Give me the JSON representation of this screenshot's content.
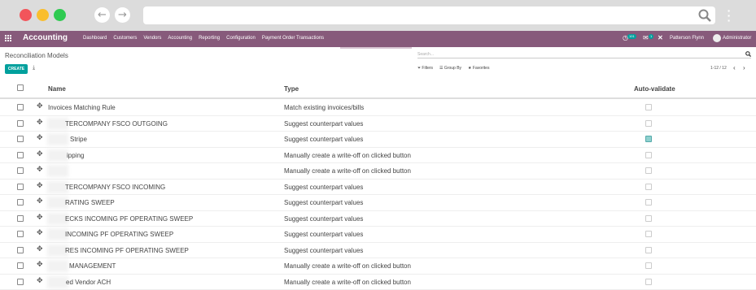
{
  "topbar": {
    "app_name": "Accounting",
    "menu": [
      "Dashboard",
      "Customers",
      "Vendors",
      "Accounting",
      "Reporting",
      "Configuration",
      "Payment Order Transactions"
    ],
    "activity_count": "101",
    "messages_count": "1",
    "company": "Patterson Flynn",
    "user": "Administrator"
  },
  "page": {
    "breadcrumb": "Reconciliation Models",
    "search_placeholder": "Search...",
    "create_label": "CREATE",
    "filters_label": "Filters",
    "group_by_label": "Group By",
    "favorites_label": "Favorites",
    "pager": "1-12 / 12"
  },
  "table": {
    "headers": {
      "name": "Name",
      "type": "Type",
      "auto_validate": "Auto-validate"
    },
    "rows": [
      {
        "name": "Invoices Matching Rule",
        "type": "Match existing invoices/bills",
        "auto": false
      },
      {
        "name": "TERCOMPANY FSCO OUTGOING",
        "type": "Suggest counterpart values",
        "auto": false
      },
      {
        "name": "Stripe",
        "type": "Suggest counterpart values",
        "auto": true
      },
      {
        "name": "ipping",
        "type": "Manually create a write-off on clicked button",
        "auto": false
      },
      {
        "name": "",
        "type": "Manually create a write-off on clicked button",
        "auto": false
      },
      {
        "name": "TERCOMPANY FSCO INCOMING",
        "type": "Suggest counterpart values",
        "auto": false
      },
      {
        "name": "RATING SWEEP",
        "type": "Suggest counterpart values",
        "auto": false
      },
      {
        "name": "ECKS INCOMING PF OPERATING SWEEP",
        "type": "Suggest counterpart values",
        "auto": false
      },
      {
        "name": "INCOMING PF OPERATING SWEEP",
        "type": "Suggest counterpart values",
        "auto": false
      },
      {
        "name": "RES INCOMING PF OPERATING SWEEP",
        "type": "Suggest counterpart values",
        "auto": false
      },
      {
        "name": "MANAGEMENT",
        "type": "Manually create a write-off on clicked button",
        "auto": false
      },
      {
        "name": "ed Vendor ACH",
        "type": "Manually create a write-off on clicked button",
        "auto": false
      }
    ]
  }
}
